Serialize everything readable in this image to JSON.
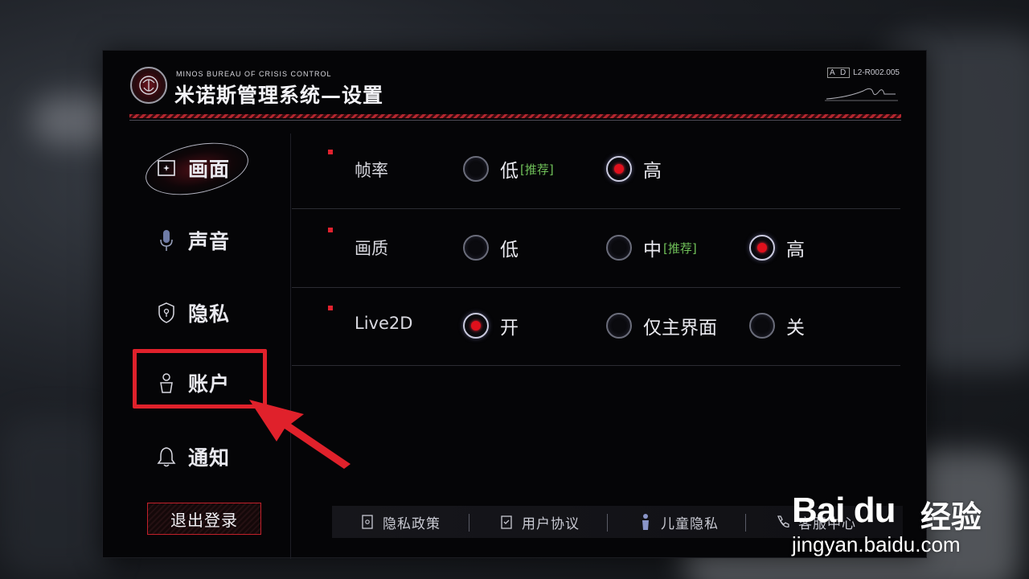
{
  "header": {
    "subtitle": "MINOS BUREAU OF  CRISIS CONTROL",
    "title": "米诺斯管理系统—设置",
    "code_ad": "A D",
    "code": "L2-R002.005"
  },
  "sidebar": {
    "items": [
      {
        "label": "画面",
        "icon": "screen-icon",
        "active": true
      },
      {
        "label": "声音",
        "icon": "microphone-icon",
        "active": false
      },
      {
        "label": "隐私",
        "icon": "shield-lock-icon",
        "active": false
      },
      {
        "label": "账户",
        "icon": "user-icon",
        "active": false
      },
      {
        "label": "通知",
        "icon": "bell-icon",
        "active": false
      }
    ],
    "logout_label": "退出登录"
  },
  "settings": {
    "rows": [
      {
        "label": "帧率",
        "options": [
          {
            "label": "低",
            "tag": "[推荐]",
            "selected": false
          },
          {
            "label": "高",
            "tag": "",
            "selected": true
          }
        ]
      },
      {
        "label": "画质",
        "options": [
          {
            "label": "低",
            "tag": "",
            "selected": false
          },
          {
            "label": "中",
            "tag": "[推荐]",
            "selected": false
          },
          {
            "label": "高",
            "tag": "",
            "selected": true
          }
        ]
      },
      {
        "label": "Live2D",
        "options": [
          {
            "label": "开",
            "tag": "",
            "selected": true
          },
          {
            "label": "仅主界面",
            "tag": "",
            "selected": false
          },
          {
            "label": "关",
            "tag": "",
            "selected": false
          }
        ]
      }
    ]
  },
  "footer": {
    "links": [
      {
        "label": "隐私政策",
        "icon": "document-icon"
      },
      {
        "label": "用户协议",
        "icon": "clipboard-icon"
      },
      {
        "label": "儿童隐私",
        "icon": "child-icon"
      },
      {
        "label": "客服中心",
        "icon": "phone-icon"
      }
    ]
  },
  "watermark": {
    "brand": "Bai du",
    "product": "经验",
    "url": "jingyan.baidu.com"
  },
  "colors": {
    "accent_red": "#e2222e",
    "tag_green": "#6fbf58",
    "highlight_red": "#e0212b"
  }
}
